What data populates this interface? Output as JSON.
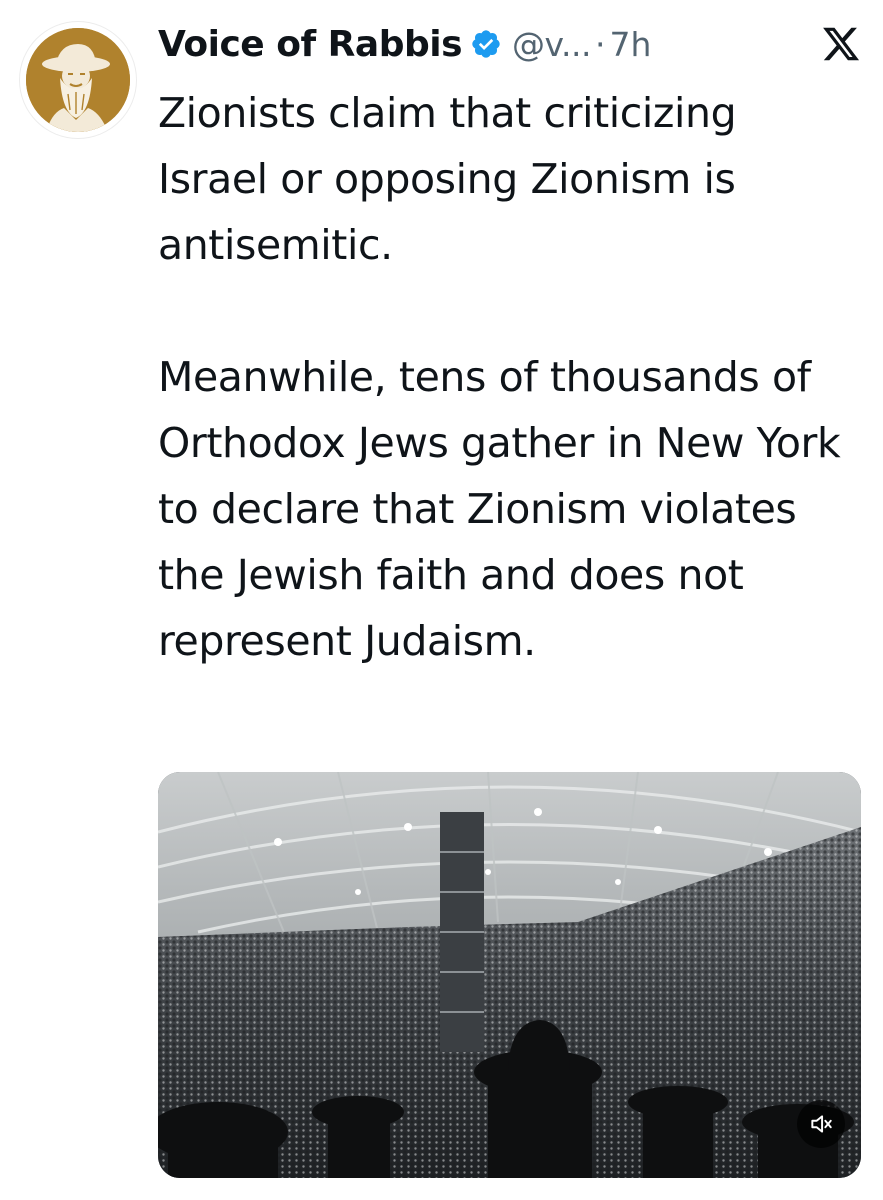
{
  "tweet": {
    "author": {
      "display_name": "Voice of Rabbis",
      "handle": "@v...",
      "verified": true,
      "avatar_icon": "rabbi-portrait-avatar"
    },
    "separator": "·",
    "time": "7h",
    "platform_icon": "x-logo-icon",
    "text": {
      "paragraph_1": "Zionists claim that criticizing Israel or opposing Zionism is antisemitic.",
      "paragraph_2": "Meanwhile, tens of thousands of Orthodox Jews gather in New York to declare that Zionism violates the Jewish faith and does not represent Judaism."
    },
    "media": {
      "type": "video",
      "mute_icon": "speaker-muted-icon"
    }
  },
  "colors": {
    "text": "#0f1419",
    "secondary_text": "#536471",
    "verified_blue": "#1d9bf0",
    "avatar_gold": "#b0822d"
  }
}
